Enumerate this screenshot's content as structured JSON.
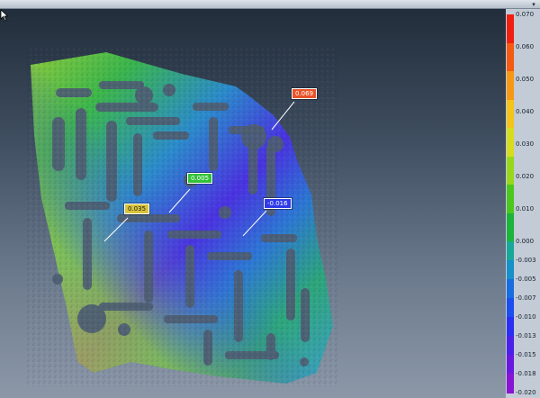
{
  "window": {
    "menu_chevron": "▾"
  },
  "deviation_map": {
    "callouts": [
      {
        "value": "0.069",
        "color": "#e8532a",
        "text_color": "#ffffff"
      },
      {
        "value": "0.005",
        "color": "#32c23a",
        "text_color": "#ffffff"
      },
      {
        "value": "0.035",
        "color": "#d9c43c",
        "text_color": "#1a1a1a"
      },
      {
        "value": "-0.016",
        "color": "#2f3be8",
        "text_color": "#ffffff"
      }
    ]
  },
  "color_scale": {
    "labels": [
      "0.070",
      "0.060",
      "0.050",
      "0.040",
      "0.030",
      "0.020",
      "0.010",
      "0.000",
      "-0.003",
      "-0.005",
      "-0.007",
      "-0.010",
      "-0.013",
      "-0.015",
      "-0.018",
      "-0.020"
    ],
    "colors_positive": [
      "#f02010",
      "#f45a10",
      "#f79814",
      "#f4c41a",
      "#d8dc1e",
      "#98d81c",
      "#4ac81e",
      "#1cb43a"
    ],
    "colors_negative": [
      "#17a89a",
      "#1690c8",
      "#176ee0",
      "#1a4ef0",
      "#2a2ef4",
      "#4a20ec",
      "#6a18e0",
      "#8a14d4"
    ]
  }
}
